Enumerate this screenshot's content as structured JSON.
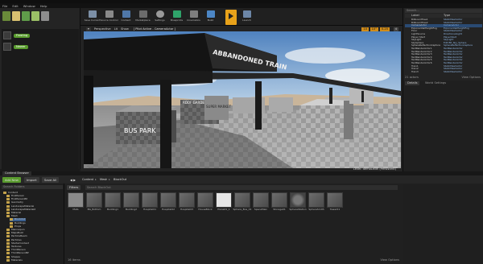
{
  "menu": [
    "File",
    "Edit",
    "Window",
    "Help"
  ],
  "toolbar": [
    "Save Current",
    "Source Control",
    "Content",
    "Marketplace",
    "Settings",
    "Blueprints",
    "Cinematics",
    "Build",
    "Play",
    "Launch"
  ],
  "modes": {
    "items": [
      {
        "label": "Frosting",
        "pill": "Frosting"
      },
      {
        "label": "Newer",
        "pill": "Newer"
      }
    ]
  },
  "viewport": {
    "perspective": "Perspective",
    "lit": "Lit",
    "show": "Show",
    "pilot": "[ Pilot Active - CameraActor ]",
    "sign_train": "ABBANDONED TRAIN",
    "sign_bus": "BUS PARK",
    "sign_roof": "ROOF GARDEN",
    "sign_super": "SUPER MARKET",
    "level_label": "Level: demoLevel (Persistent)",
    "grid_values": [
      "10",
      "10°",
      "0.25",
      "4"
    ]
  },
  "outliner": {
    "search_placeholder": "Search...",
    "columns": [
      "Label",
      "Type"
    ],
    "rows": [
      {
        "label": "BillboardTree1",
        "type": "StaticMeshActor"
      },
      {
        "label": "BillboardTree2",
        "type": "StaticMeshActor"
      },
      {
        "label": "CameraActor",
        "type": "CameraActor"
      },
      {
        "label": "ExponentialHeightFog",
        "type": "ExponentialHeightFog"
      },
      {
        "label": "Floor",
        "type": "StaticMeshActor"
      },
      {
        "label": "LightSource",
        "type": "DirectionalLight"
      },
      {
        "label": "Player Start",
        "type": "PlayerStart"
      },
      {
        "label": "SkyLight",
        "type": "SkyLight"
      },
      {
        "label": "SkySphere",
        "type": "Edit BP_Sky_Sphere"
      },
      {
        "label": "SphereReflectionCapture",
        "type": "SphereReflectionCapture"
      },
      {
        "label": "TextRenderActor1",
        "type": "TextRenderActor"
      },
      {
        "label": "TextRenderActor2",
        "type": "TextRenderActor"
      },
      {
        "label": "TextRenderActor3",
        "type": "TextRenderActor"
      },
      {
        "label": "TextRenderActor4",
        "type": "TextRenderActor"
      },
      {
        "label": "TextRenderActor5",
        "type": "TextRenderActor"
      },
      {
        "label": "TextRenderActor6",
        "type": "TextRenderActor"
      },
      {
        "label": "Train1",
        "type": "StaticMeshActor"
      },
      {
        "label": "Train2",
        "type": "StaticMeshActor"
      },
      {
        "label": "Train3",
        "type": "StaticMeshActor"
      }
    ],
    "footer": "21 actors",
    "view_options": "View Options"
  },
  "details": {
    "tab": "Details",
    "tab2": "World Settings"
  },
  "content_browser": {
    "tab": "Content Browser",
    "add_new": "Add New",
    "import": "Import",
    "save_all": "Save All",
    "breadcrumb": [
      "Content",
      "Mesh",
      "BlockOut"
    ],
    "filters": "Filters",
    "search_placeholder": "Search BlockOut",
    "tree_search": "Search Folders",
    "tree": [
      {
        "label": "Content",
        "indent": 0
      },
      {
        "label": "FirstPerson",
        "indent": 1
      },
      {
        "label": "FirstPersonBP",
        "indent": 1
      },
      {
        "label": "Geometry",
        "indent": 1
      },
      {
        "label": "LandscapeMaterial",
        "indent": 1
      },
      {
        "label": "LandscapeMaterial2",
        "indent": 1
      },
      {
        "label": "Material",
        "indent": 1
      },
      {
        "label": "Mesh",
        "indent": 1
      },
      {
        "label": "BlockOut",
        "indent": 2
      },
      {
        "label": "Buildings",
        "indent": 2
      },
      {
        "label": "Props",
        "indent": 2
      },
      {
        "label": "Mannequin",
        "indent": 1
      },
      {
        "label": "MapsBuild",
        "indent": 1
      },
      {
        "label": "ParticleBeam",
        "indent": 1
      },
      {
        "label": "Particles",
        "indent": 1
      },
      {
        "label": "StarterContent",
        "indent": 1
      },
      {
        "label": "Textures",
        "indent": 1
      },
      {
        "label": "ThirdPerson",
        "indent": 1
      },
      {
        "label": "ThirdPersonBP",
        "indent": 1
      },
      {
        "label": "Shapes",
        "indent": 1
      },
      {
        "label": "Materials",
        "indent": 1
      }
    ],
    "assets": [
      {
        "label": "Mats",
        "kind": "folder"
      },
      {
        "label": "BG_Bottom",
        "kind": "mesh"
      },
      {
        "label": "Building1",
        "kind": "mesh"
      },
      {
        "label": "Building2",
        "kind": "mesh"
      },
      {
        "label": "Hospital01",
        "kind": "mesh"
      },
      {
        "label": "Hospital02",
        "kind": "mesh"
      },
      {
        "label": "Hospital03",
        "kind": "mesh"
      },
      {
        "label": "HouseBlock",
        "kind": "mesh"
      },
      {
        "label": "Plane01_1",
        "kind": "white"
      },
      {
        "label": "Sphere_Bus_01",
        "kind": "mesh"
      },
      {
        "label": "SpaceMain",
        "kind": "mesh"
      },
      {
        "label": "Storage01",
        "kind": "mesh"
      },
      {
        "label": "SphereStation",
        "kind": "sphere"
      },
      {
        "label": "SphereSmith",
        "kind": "mesh"
      },
      {
        "label": "Tower01",
        "kind": "mesh"
      }
    ],
    "footer": "16 items",
    "view_options": "View Options"
  },
  "colors": {
    "accent": "#e8a21a",
    "pill": "#5a9c2e",
    "sky": "#6f98c4"
  }
}
